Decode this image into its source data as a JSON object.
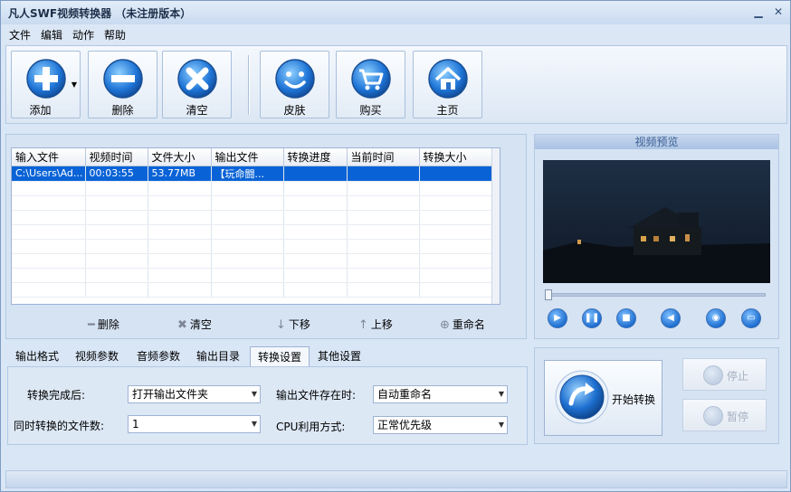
{
  "window": {
    "title": "凡人SWF视频转换器  （未注册版本）",
    "min": "▁",
    "close": "✕"
  },
  "menu": [
    "文件",
    "编辑",
    "动作",
    "帮助"
  ],
  "toolbar": {
    "add": "添加",
    "delete": "删除",
    "clear": "清空",
    "skin": "皮肤",
    "buy": "购买",
    "home": "主页"
  },
  "table": {
    "headers": [
      "输入文件",
      "视频时间",
      "文件大小",
      "输出文件",
      "转换进度",
      "当前时间",
      "转换大小"
    ],
    "rows": [
      [
        "C:\\Users\\Ad...",
        "00:03:55",
        "53.77MB",
        "【玩命闘...",
        "",
        "",
        ""
      ]
    ]
  },
  "list_actions": {
    "delete": "删除",
    "clear": "清空",
    "down": "下移",
    "up": "上移",
    "rename": "重命名"
  },
  "preview": {
    "header": "视频预览"
  },
  "tabs": [
    "输出格式",
    "视频参数",
    "音频参数",
    "输出目录",
    "转换设置",
    "其他设置"
  ],
  "settings": {
    "after_done_label": "转换完成后:",
    "after_done_value": "打开输出文件夹",
    "exists_label": "输出文件存在时:",
    "exists_value": "自动重命名",
    "concurrent_label": "同时转换的文件数:",
    "concurrent_value": "1",
    "cpu_label": "CPU利用方式:",
    "cpu_value": "正常优先级"
  },
  "convert": {
    "start": "开始转换",
    "stop": "停止",
    "pause": "暂停"
  }
}
